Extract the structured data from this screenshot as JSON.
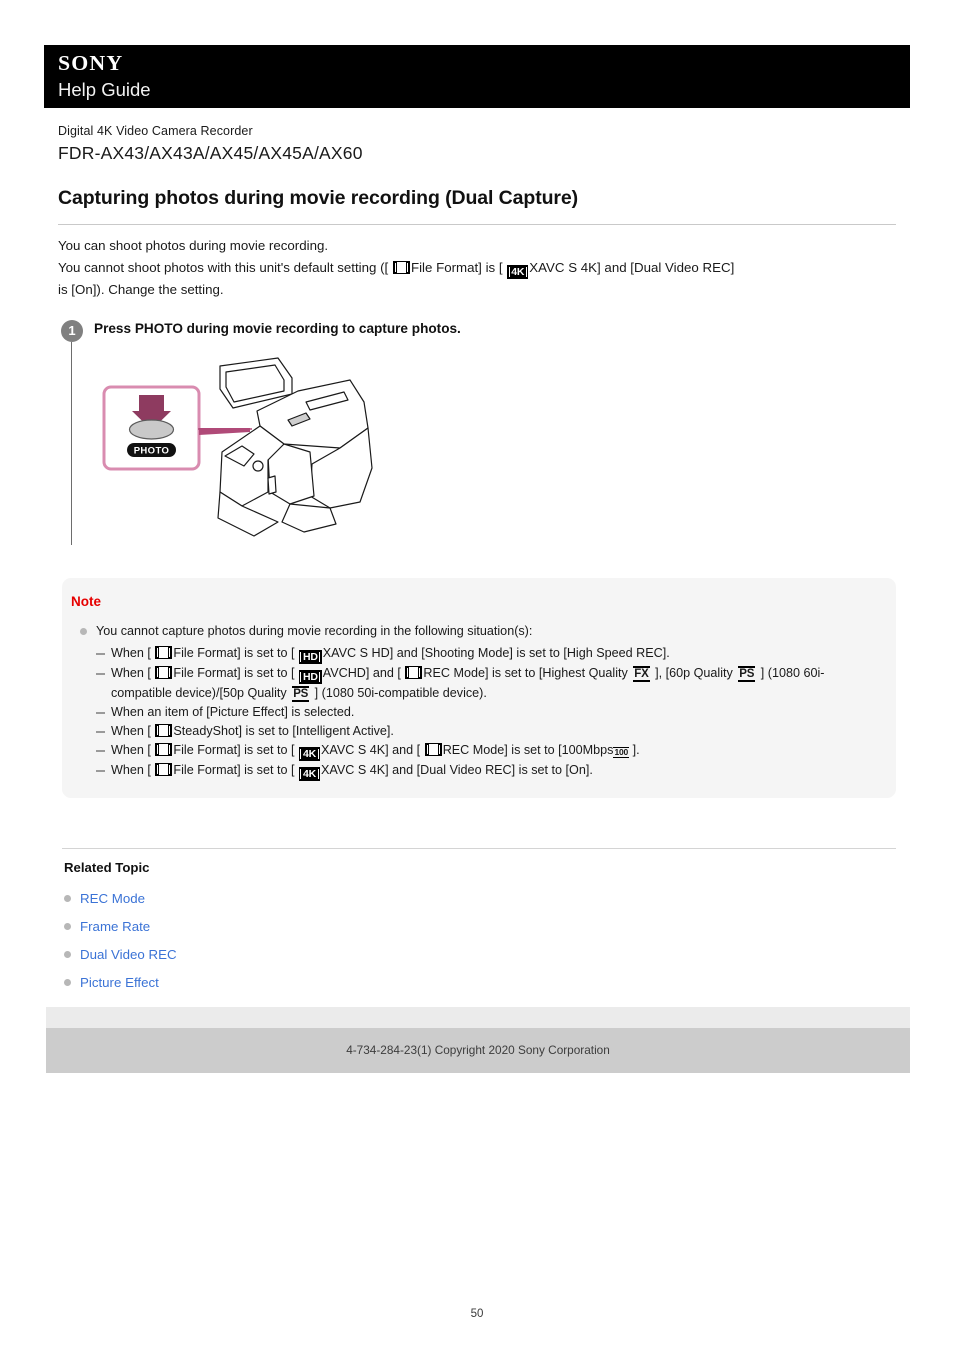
{
  "header": {
    "brand": "SONY",
    "subtitle": "Help Guide"
  },
  "product": {
    "kind": "Digital 4K Video Camera Recorder",
    "model": "FDR-AX43/AX43A/AX45/AX45A/AX60"
  },
  "article": {
    "title": "Capturing photos during movie recording (Dual Capture)",
    "intro_line1": "You can shoot photos during movie recording.",
    "intro_line2_a": "You cannot shoot photos with this unit's default setting ([ ",
    "intro_line2_b": "File Format] is [ ",
    "intro_icon_label": "4K",
    "intro_line2_c": "XAVC S 4K] and [Dual Video REC] ",
    "intro_line2_d": "is [On]). Change the setting."
  },
  "step": {
    "number": "1",
    "text": "Press PHOTO during movie recording to capture photos.",
    "illustration_button_label": "PHOTO"
  },
  "note": {
    "heading": "Note",
    "lead": "You cannot capture photos during movie recording in the following situation(s):",
    "items": [
      {
        "parts": [
          {
            "t": "text",
            "v": "When [ "
          },
          {
            "t": "film"
          },
          {
            "t": "text",
            "v": "File Format] is set to [ "
          },
          {
            "t": "fmt",
            "v": "HD"
          },
          {
            "t": "text",
            "v": "XAVC S HD] and [Shooting Mode] is set to [High Speed REC]."
          }
        ]
      },
      {
        "parts": [
          {
            "t": "text",
            "v": "When [ "
          },
          {
            "t": "film"
          },
          {
            "t": "text",
            "v": "File Format] is set to [ "
          },
          {
            "t": "fmt",
            "v": "HD"
          },
          {
            "t": "text",
            "v": "AVCHD] and [ "
          },
          {
            "t": "film"
          },
          {
            "t": "text",
            "v": "REC Mode] is set to [Highest Quality "
          },
          {
            "t": "bar",
            "v": "FX"
          },
          {
            "t": "text",
            "v": " ], [60p Quality "
          },
          {
            "t": "bar",
            "v": "PS"
          },
          {
            "t": "text",
            "v": " ] (1080 60i-compatible device)/[50p Quality "
          },
          {
            "t": "bar",
            "v": "PS"
          },
          {
            "t": "text",
            "v": " ] (1080 50i-compatible device)."
          }
        ]
      },
      {
        "parts": [
          {
            "t": "text",
            "v": "When an item of [Picture Effect] is selected."
          }
        ]
      },
      {
        "parts": [
          {
            "t": "text",
            "v": "When [ "
          },
          {
            "t": "film"
          },
          {
            "t": "text",
            "v": "SteadyShot] is set to [Intelligent Active]."
          }
        ]
      },
      {
        "parts": [
          {
            "t": "text",
            "v": "When [ "
          },
          {
            "t": "film"
          },
          {
            "t": "text",
            "v": "File Format] is set to [ "
          },
          {
            "t": "fmt",
            "v": "4K"
          },
          {
            "t": "text",
            "v": "XAVC S 4K] and [ "
          },
          {
            "t": "film"
          },
          {
            "t": "text",
            "v": "REC Mode] is set to [100Mbps"
          },
          {
            "t": "bartiny",
            "v": "100"
          },
          {
            "t": "text",
            "v": " ]."
          }
        ]
      },
      {
        "parts": [
          {
            "t": "text",
            "v": "When [ "
          },
          {
            "t": "film"
          },
          {
            "t": "text",
            "v": "File Format] is set to [ "
          },
          {
            "t": "fmt",
            "v": "4K"
          },
          {
            "t": "text",
            "v": "XAVC S 4K] and [Dual Video REC] is set to [On]."
          }
        ]
      }
    ]
  },
  "related": {
    "title": "Related Topic",
    "links": [
      "REC Mode",
      "Frame Rate",
      "Dual Video REC",
      "Picture Effect"
    ]
  },
  "footer": {
    "copyright": "4-734-284-23(1) Copyright 2020 Sony Corporation",
    "page_number": "50"
  },
  "colors": {
    "header_bg": "#000000",
    "note_heading": "#e60000",
    "link": "#3b73d6",
    "note_bg": "#f5f5f5",
    "callout_border": "#d98cb0",
    "arrow": "#8e3b60"
  }
}
